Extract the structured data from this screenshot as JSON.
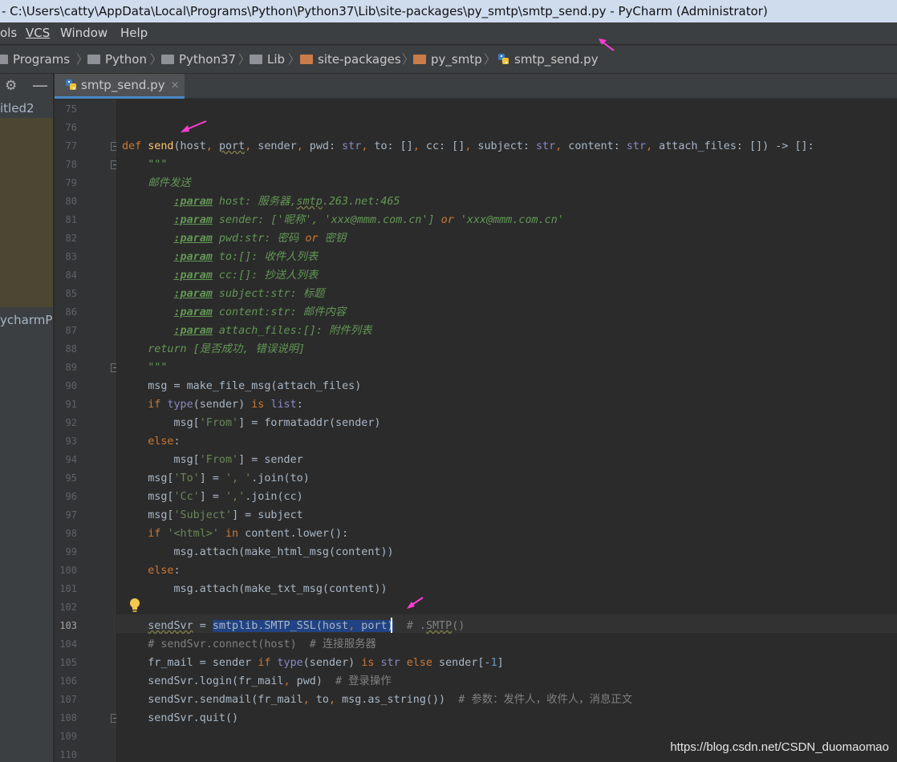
{
  "window": {
    "title": "- C:\\Users\\catty\\AppData\\Local\\Programs\\Python\\Python37\\Lib\\site-packages\\py_smtp\\smtp_send.py - PyCharm (Administrator)"
  },
  "menu": {
    "items": [
      {
        "label": "ols"
      },
      {
        "label": "VCS"
      },
      {
        "label": "Window"
      },
      {
        "label": "Help"
      }
    ]
  },
  "breadcrumb": {
    "items": [
      {
        "label": "Programs"
      },
      {
        "label": "Python"
      },
      {
        "label": "Python37"
      },
      {
        "label": "Lib"
      },
      {
        "label": "site-packages"
      },
      {
        "label": "py_smtp"
      },
      {
        "label": "smtp_send.py"
      }
    ]
  },
  "sidebar": {
    "items": [
      {
        "label": "itled2"
      },
      {
        "label": "ycharmPr"
      }
    ]
  },
  "tab": {
    "label": "smtp_send.py",
    "close": "×"
  },
  "editor": {
    "current_line": "103",
    "lines": [
      {
        "n": "75",
        "t": ""
      },
      {
        "n": "76",
        "t": ""
      },
      {
        "n": "77",
        "t": "def send(host, port, sender, pwd: str, to: [], cc: [], subject: str, content: str, attach_files: []) -> []:"
      },
      {
        "n": "78",
        "t": "    \"\"\""
      },
      {
        "n": "79",
        "t": "    邮件发送"
      },
      {
        "n": "80",
        "t": "        :param host: 服务器,smtp.263.net:465"
      },
      {
        "n": "81",
        "t": "        :param sender: ['昵称', 'xxx@mmm.com.cn'] or 'xxx@mmm.com.cn'"
      },
      {
        "n": "82",
        "t": "        :param pwd:str: 密码 or 密钥"
      },
      {
        "n": "83",
        "t": "        :param to:[]: 收件人列表"
      },
      {
        "n": "84",
        "t": "        :param cc:[]: 抄送人列表"
      },
      {
        "n": "85",
        "t": "        :param subject:str: 标题"
      },
      {
        "n": "86",
        "t": "        :param content:str: 邮件内容"
      },
      {
        "n": "87",
        "t": "        :param attach_files:[]: 附件列表"
      },
      {
        "n": "88",
        "t": "    return [是否成功, 错误说明]"
      },
      {
        "n": "89",
        "t": "    \"\"\""
      },
      {
        "n": "90",
        "t": "    msg = make_file_msg(attach_files)"
      },
      {
        "n": "91",
        "t": "    if type(sender) is list:"
      },
      {
        "n": "92",
        "t": "        msg['From'] = formataddr(sender)"
      },
      {
        "n": "93",
        "t": "    else:"
      },
      {
        "n": "94",
        "t": "        msg['From'] = sender"
      },
      {
        "n": "95",
        "t": "    msg['To'] = ', '.join(to)"
      },
      {
        "n": "96",
        "t": "    msg['Cc'] = ','.join(cc)"
      },
      {
        "n": "97",
        "t": "    msg['Subject'] = subject"
      },
      {
        "n": "98",
        "t": "    if '<html>' in content.lower():"
      },
      {
        "n": "99",
        "t": "        msg.attach(make_html_msg(content))"
      },
      {
        "n": "100",
        "t": "    else:"
      },
      {
        "n": "101",
        "t": "        msg.attach(make_txt_msg(content))"
      },
      {
        "n": "102",
        "t": ""
      },
      {
        "n": "103",
        "t": "    sendSvr = smtplib.SMTP_SSL(host, port)  # .SMTP()"
      },
      {
        "n": "104",
        "t": "    # sendSvr.connect(host)  # 连接服务器"
      },
      {
        "n": "105",
        "t": "    fr_mail = sender if type(sender) is str else sender[-1]"
      },
      {
        "n": "106",
        "t": "    sendSvr.login(fr_mail, pwd)  # 登录操作"
      },
      {
        "n": "107",
        "t": "    sendSvr.sendmail(fr_mail, to, msg.as_string())  # 参数：发件人，收件人，消息正文"
      },
      {
        "n": "108",
        "t": "    sendSvr.quit()"
      },
      {
        "n": "109",
        "t": ""
      },
      {
        "n": "110",
        "t": ""
      }
    ]
  },
  "watermark": "https://blog.csdn.net/CSDN_duomaomao",
  "colors": {
    "keyword": "#cc7832",
    "function": "#ffc66d",
    "builtin": "#8888c6",
    "string": "#6a8759",
    "docstring": "#629755",
    "comment": "#808080",
    "number": "#6897bb",
    "selection": "#214283",
    "annotation_arrow": "#ff3dd5"
  }
}
